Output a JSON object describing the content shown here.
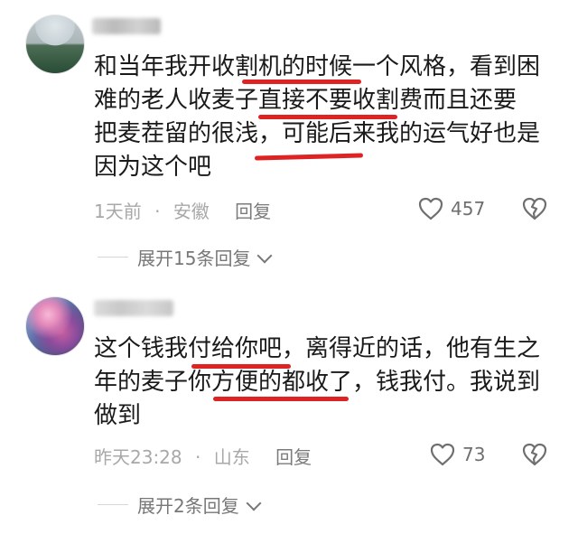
{
  "comments": [
    {
      "text_lines": [
        "和当年我开收割机的时候一个风格，看到困",
        "难的老人收麦子直接不要收割费而且还要",
        "把麦茬留的很浅，可能后来我的运气好也是",
        "因为这个吧"
      ],
      "time": "1天前",
      "separator": "·",
      "location": "安徽",
      "reply_label": "回复",
      "likes": "457",
      "expand_label": "展开15条回复"
    },
    {
      "text_lines": [
        "这个钱我付给你吧，离得近的话，他有生之",
        "年的麦子你方便的都收了，钱我付。我说到",
        "做到"
      ],
      "time": "昨天23:28",
      "separator": "·",
      "location": "山东",
      "reply_label": "回复",
      "likes": "73",
      "expand_label": "展开2条回复"
    }
  ],
  "colors": {
    "annotation": "#dd2323",
    "meta": "#a8a8a8",
    "text": "#1a1a1a"
  },
  "icons": {
    "like": "heart-outline-icon",
    "dislike": "broken-heart-icon",
    "expand": "chevron-down-icon"
  }
}
